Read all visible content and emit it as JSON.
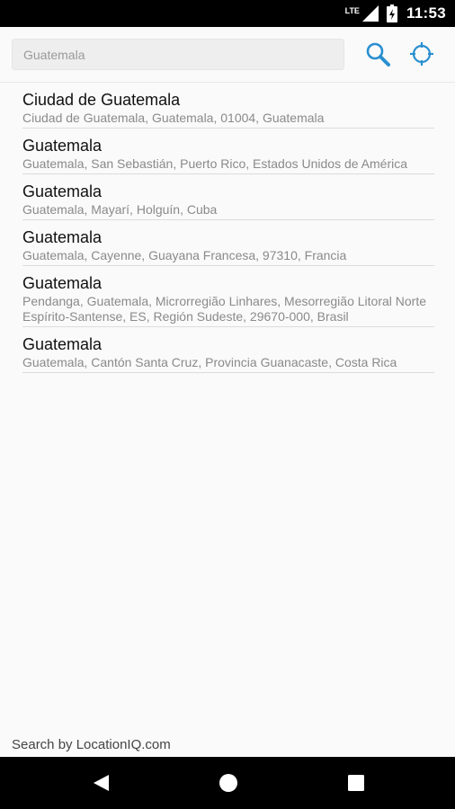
{
  "status_bar": {
    "network": "LTE",
    "time": "11:53"
  },
  "search": {
    "placeholder": "Guatemala",
    "value": ""
  },
  "icons": {
    "search": "search-icon",
    "locate": "crosshair-icon",
    "accent_color": "#2a8fd0"
  },
  "results": [
    {
      "title": "Ciudad de Guatemala",
      "subtitle": "Ciudad de Guatemala, Guatemala, 01004, Guatemala"
    },
    {
      "title": "Guatemala",
      "subtitle": "Guatemala, San Sebastián, Puerto Rico, Estados Unidos de América"
    },
    {
      "title": "Guatemala",
      "subtitle": "Guatemala, Mayarí, Holguín, Cuba"
    },
    {
      "title": "Guatemala",
      "subtitle": "Guatemala, Cayenne, Guayana Francesa, 97310, Francia"
    },
    {
      "title": "Guatemala",
      "subtitle": "Pendanga, Guatemala, Microrregião Linhares, Mesorregião Litoral Norte Espírito-Santense, ES, Región Sudeste, 29670-000, Brasil"
    },
    {
      "title": "Guatemala",
      "subtitle": "Guatemala, Cantón Santa Cruz, Provincia Guanacaste, Costa Rica"
    }
  ],
  "footer": {
    "credit": "Search by LocationIQ.com"
  }
}
